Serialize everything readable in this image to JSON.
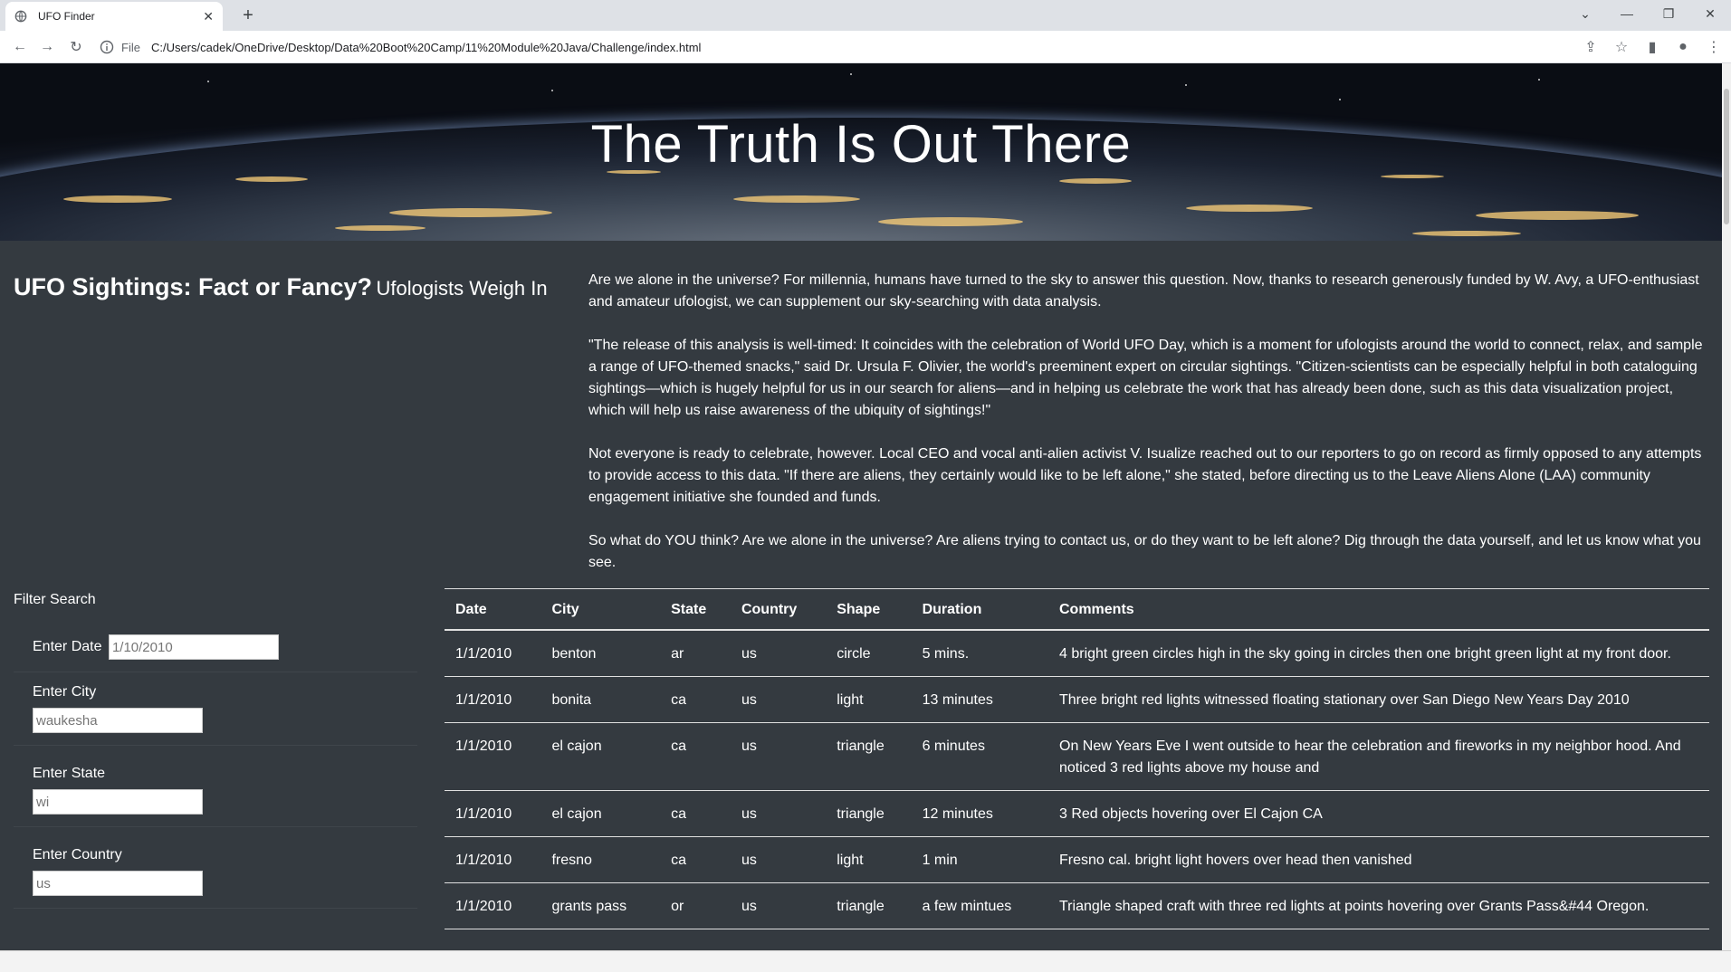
{
  "browser": {
    "tab_title": "UFO Finder",
    "url_scheme": "File",
    "url": "C:/Users/cadek/OneDrive/Desktop/Data%20Boot%20Camp/11%20Module%20Java/Challenge/index.html"
  },
  "hero": {
    "title": "The Truth Is Out There"
  },
  "intro": {
    "title": "UFO Sightings: Fact or Fancy?",
    "subtitle": "Ufologists Weigh In",
    "paragraphs": [
      "Are we alone in the universe? For millennia, humans have turned to the sky to answer this question. Now, thanks to research generously funded by W. Avy, a UFO-enthusiast and amateur ufologist, we can supplement our sky-searching with data analysis.",
      "\"The release of this analysis is well-timed: It coincides with the celebration of World UFO Day, which is a moment for ufologists around the world to connect, relax, and sample a range of UFO-themed snacks,\" said Dr. Ursula F. Olivier, the world's preeminent expert on circular sightings. \"Citizen-scientists can be especially helpful in both cataloguing sightings—which is hugely helpful for us in our search for aliens—and in helping us celebrate the work that has already been done, such as this data visualization project, which will help us raise awareness of the ubiquity of sightings!\"",
      "Not everyone is ready to celebrate, however. Local CEO and vocal anti-alien activist V. Isualize reached out to our reporters to go on record as firmly opposed to any attempts to provide access to this data. \"If there are aliens, they certainly would like to be left alone,\" she stated, before directing us to the Leave Aliens Alone (LAA) community engagement initiative she founded and funds.",
      "So what do YOU think? Are we alone in the universe? Are aliens trying to contact us, or do they want to be left alone? Dig through the data yourself, and let us know what you see."
    ]
  },
  "filters": {
    "heading": "Filter Search",
    "date": {
      "label": "Enter Date",
      "placeholder": "1/10/2010"
    },
    "city": {
      "label": "Enter City",
      "placeholder": "waukesha"
    },
    "state": {
      "label": "Enter State",
      "placeholder": "wi"
    },
    "country": {
      "label": "Enter Country",
      "placeholder": "us"
    }
  },
  "table": {
    "headers": [
      "Date",
      "City",
      "State",
      "Country",
      "Shape",
      "Duration",
      "Comments"
    ],
    "rows": [
      [
        "1/1/2010",
        "benton",
        "ar",
        "us",
        "circle",
        "5 mins.",
        "4 bright green circles high in the sky going in circles then one bright green light at my front door."
      ],
      [
        "1/1/2010",
        "bonita",
        "ca",
        "us",
        "light",
        "13 minutes",
        "Three bright red lights witnessed floating stationary over San Diego New Years Day 2010"
      ],
      [
        "1/1/2010",
        "el cajon",
        "ca",
        "us",
        "triangle",
        "6 minutes",
        "On New Years Eve I went outside to hear the celebration and fireworks in my neighbor hood. And noticed 3 red lights above my house and"
      ],
      [
        "1/1/2010",
        "el cajon",
        "ca",
        "us",
        "triangle",
        "12 minutes",
        "3 Red objects hovering over El Cajon CA"
      ],
      [
        "1/1/2010",
        "fresno",
        "ca",
        "us",
        "light",
        "1 min",
        "Fresno cal. bright light hovers over head then vanished"
      ],
      [
        "1/1/2010",
        "grants pass",
        "or",
        "us",
        "triangle",
        "a few mintues",
        "Triangle shaped craft with three red lights at points hovering over Grants Pass&#44 Oregon."
      ]
    ]
  }
}
